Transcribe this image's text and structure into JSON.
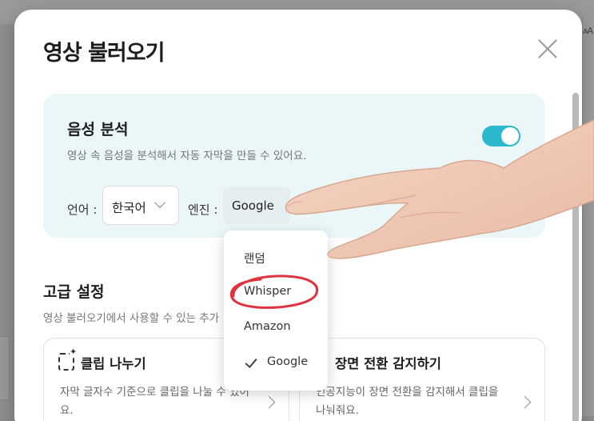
{
  "background": {
    "right_label": "ᴀA"
  },
  "modal": {
    "title": "영상 불러오기"
  },
  "voice_analysis": {
    "title": "음성 분석",
    "description": "영상 속 음성을 분석해서 자동 자막을 만들 수 있어요.",
    "toggle_on": true,
    "language_label": "언어 :",
    "language_value": "한국어",
    "engine_label": "엔진 :",
    "engine_value": "Google"
  },
  "engine_dropdown": {
    "options": [
      {
        "label": "랜덤",
        "selected": false
      },
      {
        "label": "Whisper",
        "selected": false,
        "highlighted": true
      },
      {
        "label": "Amazon",
        "selected": false
      },
      {
        "label": "Google",
        "selected": true
      }
    ]
  },
  "advanced": {
    "title": "고급 설정",
    "description": "영상 불러오기에서 사용할 수 있는 추가",
    "cards": [
      {
        "title": "클립 나누기",
        "description": "자막 글자수 기준으로 클립을 나눌 수 있어요."
      },
      {
        "title": "장면 전환 감지하기",
        "description": "인공지능이 장면 전환을 감지해서 클립을 나눠줘요."
      }
    ]
  },
  "colors": {
    "accent": "#2bb7cc",
    "card_bg": "#eaf6f7",
    "highlight_circle": "#e0333f"
  }
}
